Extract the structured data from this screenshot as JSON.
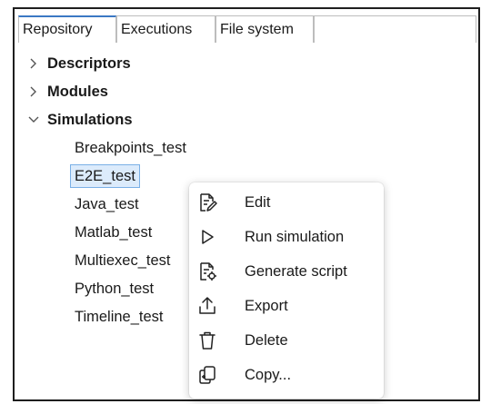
{
  "tabs": [
    {
      "label": "Repository",
      "active": true
    },
    {
      "label": "Executions",
      "active": false
    },
    {
      "label": "File system",
      "active": false
    }
  ],
  "tree": {
    "folders": [
      {
        "label": "Descriptors",
        "expanded": false
      },
      {
        "label": "Modules",
        "expanded": false
      },
      {
        "label": "Simulations",
        "expanded": true
      }
    ],
    "simulations": [
      "Breakpoints_test",
      "E2E_test",
      "Java_test",
      "Matlab_test",
      "Multiexec_test",
      "Python_test",
      "Timeline_test"
    ],
    "selected_item": "E2E_test"
  },
  "context_menu": {
    "items": [
      {
        "label": "Edit",
        "icon": "edit-document-icon"
      },
      {
        "label": "Run simulation",
        "icon": "play-icon"
      },
      {
        "label": "Generate script",
        "icon": "script-gear-icon"
      },
      {
        "label": "Export",
        "icon": "export-upload-icon"
      },
      {
        "label": "Delete",
        "icon": "trash-icon"
      },
      {
        "label": "Copy...",
        "icon": "copy-icon"
      }
    ]
  },
  "colors": {
    "tab_accent": "#3b78c4",
    "selection_fill": "#dcebfb",
    "selection_border": "#7ab0e6",
    "frame_border": "#1e1e1e"
  }
}
